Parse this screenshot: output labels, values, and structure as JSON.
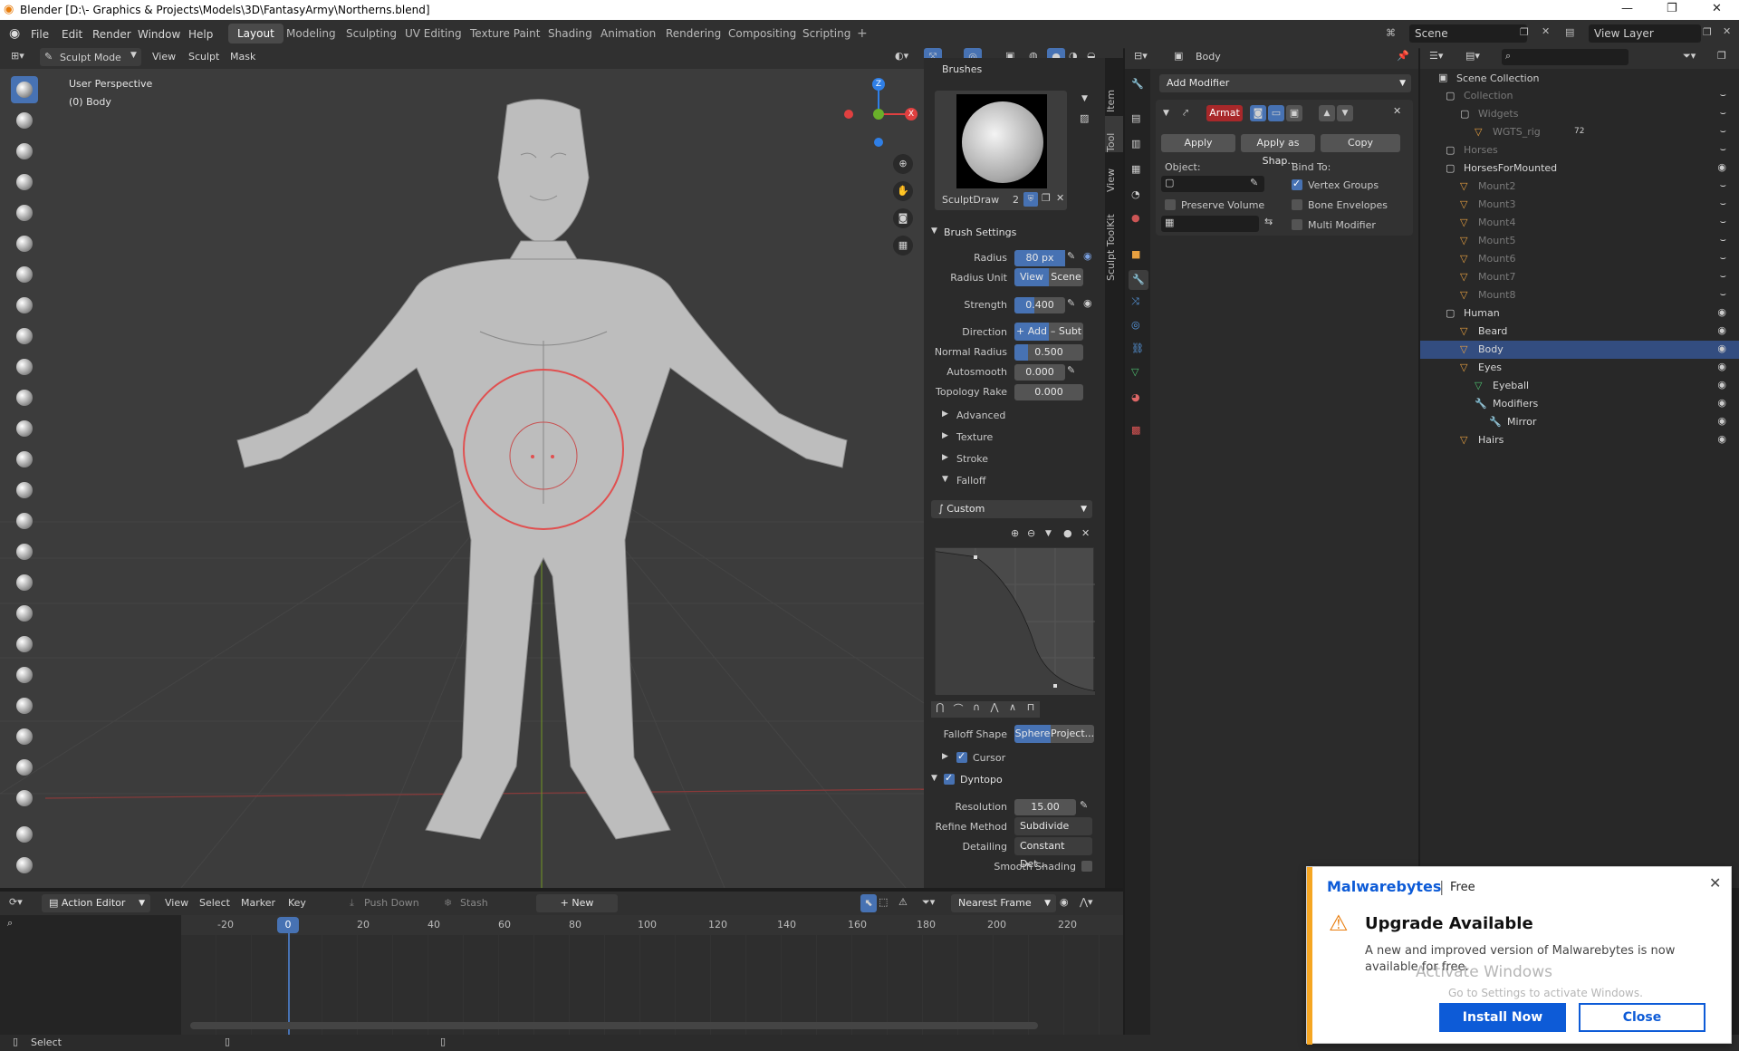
{
  "window": {
    "title": "Blender [D:\\- Graphics & Projects\\Models\\3D\\FantasyArmy\\Northerns.blend]"
  },
  "menu": {
    "items": [
      "File",
      "Edit",
      "Render",
      "Window",
      "Help"
    ]
  },
  "workspaces": [
    "Layout",
    "Modeling",
    "Sculpting",
    "UV Editing",
    "Texture Paint",
    "Shading",
    "Animation",
    "Rendering",
    "Compositing",
    "Scripting"
  ],
  "scene": {
    "name": "Scene",
    "view_layer": "View Layer"
  },
  "viewport": {
    "mode": "Sculpt Mode",
    "menus": [
      "View",
      "Sculpt",
      "Mask"
    ],
    "overlay_line1": "User Perspective",
    "overlay_line2": "(0) Body"
  },
  "gizmo": {
    "z": "Z",
    "x": "X"
  },
  "brush": {
    "section": "Brushes",
    "name": "SculptDraw",
    "users": "2"
  },
  "brush_settings": {
    "title": "Brush Settings",
    "radius_label": "Radius",
    "radius": "80 px",
    "radius_unit_label": "Radius Unit",
    "unit_view": "View",
    "unit_scene": "Scene",
    "strength_label": "Strength",
    "strength": "0.400",
    "strength_value": 0.4,
    "direction_label": "Direction",
    "dir_add": "+ Add",
    "dir_sub": "– Subt",
    "normal_radius_label": "Normal Radius",
    "normal_radius": "0.500",
    "normal_radius_value": 0.5,
    "autosmooth_label": "Autosmooth",
    "autosmooth": "0.000",
    "topology_label": "Topology Rake",
    "topology": "0.000"
  },
  "subpanels": [
    "Advanced",
    "Texture",
    "Stroke",
    "Falloff"
  ],
  "falloff": {
    "preset": "Custom",
    "shape_label": "Falloff Shape",
    "shape_sphere": "Sphere",
    "shape_proj": "Project..."
  },
  "cursor": {
    "label": "Cursor"
  },
  "dyntopo": {
    "title": "Dyntopo",
    "resolution_label": "Resolution",
    "resolution": "15.00",
    "refine_label": "Refine Method",
    "refine": "Subdivide Co...",
    "detailing_label": "Detailing",
    "detailing": "Constant Det...",
    "smooth_label": "Smooth Shading"
  },
  "tabs_vertical": [
    "Item",
    "Tool",
    "View",
    "Sculpt ToolKit"
  ],
  "properties": {
    "object": "Body",
    "add_modifier": "Add Modifier",
    "mod_name": "Armat",
    "apply": "Apply",
    "apply_shape": "Apply as Shap..",
    "copy": "Copy",
    "object_label": "Object:",
    "bind_to": "Bind To:",
    "vertex_groups": "Vertex Groups",
    "preserve_volume": "Preserve Volume",
    "bone_envelopes": "Bone Envelopes",
    "multi_modifier": "Multi Modifier"
  },
  "outliner": {
    "root": "Scene Collection",
    "rows": [
      {
        "name": "Collection",
        "dim": true
      },
      {
        "name": "Widgets",
        "dim": true
      },
      {
        "name": "WGTS_rig",
        "dim": true,
        "badge": "72"
      },
      {
        "name": "Horses",
        "dim": true
      },
      {
        "name": "HorsesForMounted",
        "dim": false
      },
      {
        "name": "Mount2",
        "dim": true
      },
      {
        "name": "Mount3",
        "dim": true
      },
      {
        "name": "Mount4",
        "dim": true
      },
      {
        "name": "Mount5",
        "dim": true
      },
      {
        "name": "Mount6",
        "dim": true
      },
      {
        "name": "Mount7",
        "dim": true
      },
      {
        "name": "Mount8",
        "dim": true
      },
      {
        "name": "Human",
        "dim": false
      },
      {
        "name": "Beard",
        "dim": false
      },
      {
        "name": "Body",
        "dim": false,
        "selected": true
      },
      {
        "name": "Eyes",
        "dim": false
      },
      {
        "name": "Eyeball",
        "dim": false
      },
      {
        "name": "Modifiers",
        "dim": false
      },
      {
        "name": "Mirror",
        "dim": false
      },
      {
        "name": "Hairs",
        "dim": false
      }
    ]
  },
  "timeline": {
    "editor": "Action Editor",
    "menus": [
      "View",
      "Select",
      "Marker",
      "Key"
    ],
    "push_down": "Push Down",
    "stash": "Stash",
    "new": "New",
    "snap": "Nearest Frame",
    "current_frame": "0",
    "ticks": [
      "-20",
      "20",
      "40",
      "60",
      "80",
      "100",
      "120",
      "140",
      "160",
      "180",
      "200",
      "220"
    ]
  },
  "statusbar": {
    "left": "Select"
  },
  "popup": {
    "brand": "Malwarebytes",
    "tier": "Free",
    "title": "Upgrade Available",
    "message": "A new and improved version of Malwarebytes is now available for free.",
    "install": "Install Now",
    "close": "Close",
    "watermark1": "Activate Windows",
    "watermark2": "Go to Settings to activate Windows."
  },
  "colors": {
    "accent": "#4772b3",
    "brush_ring": "#e05050",
    "popup_orange": "#f5a623",
    "popup_blue": "#0d5bd7"
  }
}
